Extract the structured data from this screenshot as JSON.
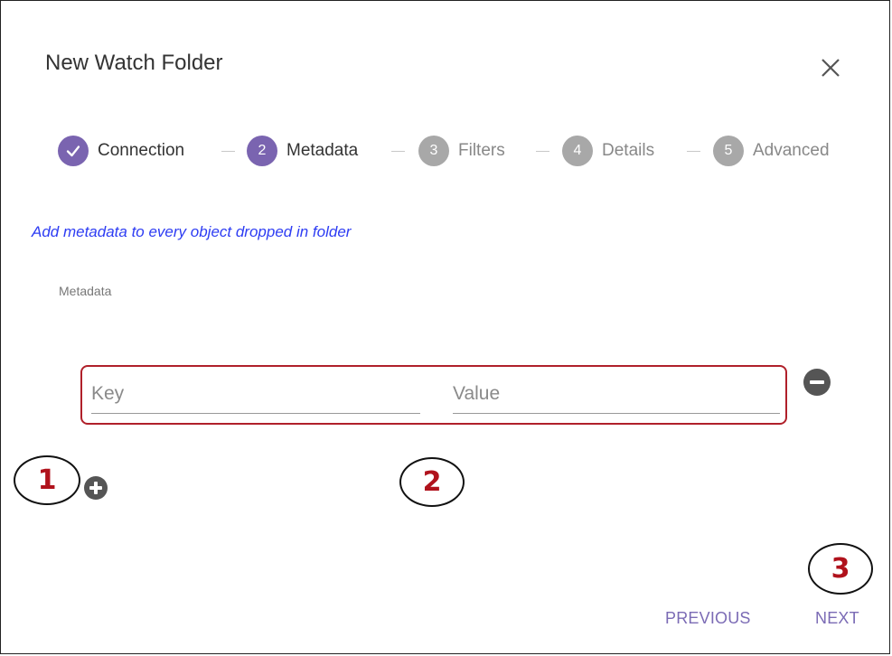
{
  "dialog": {
    "title": "New Watch Folder"
  },
  "stepper": {
    "steps": [
      {
        "number": "✓",
        "label": "Connection",
        "state": "completed"
      },
      {
        "number": "2",
        "label": "Metadata",
        "state": "active"
      },
      {
        "number": "3",
        "label": "Filters",
        "state": "pending"
      },
      {
        "number": "4",
        "label": "Details",
        "state": "pending"
      },
      {
        "number": "5",
        "label": "Advanced",
        "state": "pending"
      }
    ]
  },
  "content": {
    "hint": "Add metadata to every object dropped in folder",
    "section_label": "Metadata",
    "row": {
      "key_placeholder": "Key",
      "value_placeholder": "Value",
      "key_value": "",
      "value_value": ""
    }
  },
  "annotations": [
    "1",
    "2",
    "3"
  ],
  "footer": {
    "previous_label": "PREVIOUS",
    "next_label": "NEXT"
  },
  "colors": {
    "accent": "#7b6bb5",
    "step_active": "#7a64b0",
    "step_pending": "#a8a8a8",
    "hint": "#2d3cf3",
    "highlight": "#b0202a"
  }
}
